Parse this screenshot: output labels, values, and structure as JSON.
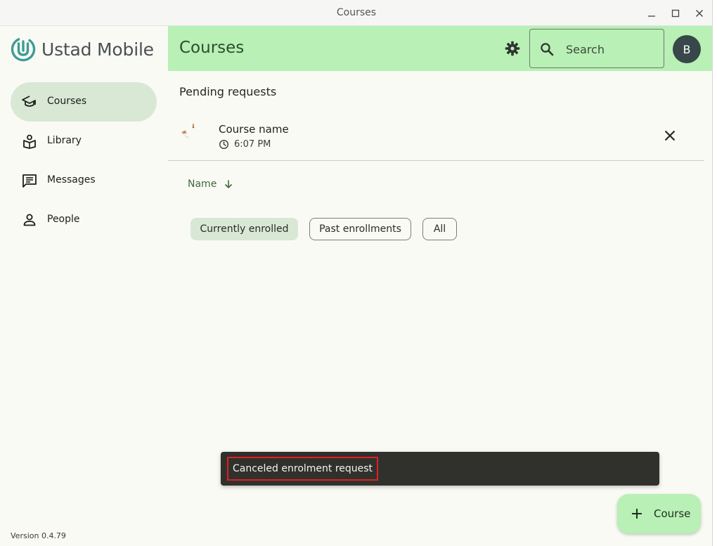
{
  "window": {
    "title": "Courses"
  },
  "app": {
    "name": "Ustad Mobile",
    "version": "Version 0.4.79"
  },
  "sidebar": {
    "items": [
      {
        "label": "Courses",
        "icon": "school-icon",
        "active": true
      },
      {
        "label": "Library",
        "icon": "library-icon",
        "active": false
      },
      {
        "label": "Messages",
        "icon": "message-icon",
        "active": false
      },
      {
        "label": "People",
        "icon": "person-icon",
        "active": false
      }
    ]
  },
  "header": {
    "title": "Courses",
    "search_placeholder": "Search",
    "avatar_initial": "B"
  },
  "pending": {
    "title": "Pending requests",
    "requests": [
      {
        "course_name": "Course name",
        "time": "6:07 PM"
      }
    ]
  },
  "sort": {
    "label": "Name",
    "direction": "descending"
  },
  "filters": [
    {
      "label": "Currently enrolled",
      "selected": true
    },
    {
      "label": "Past enrollments",
      "selected": false
    },
    {
      "label": "All",
      "selected": false
    }
  ],
  "snackbar": {
    "message": "Canceled enrolment request"
  },
  "fab": {
    "label": "Course"
  },
  "colors": {
    "header_bg": "#b8f0b5",
    "nav_active_bg": "#d8e8d5",
    "logo_teal": "#3e9c96",
    "avatar_bg": "#37474a",
    "snackbar_bg": "#30312d",
    "highlight_red": "#e02020"
  }
}
